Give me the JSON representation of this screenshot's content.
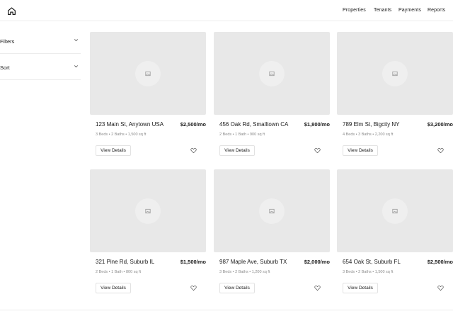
{
  "icons": {
    "home": "home-icon",
    "chevron": "chevron-down-icon",
    "placeholder": "image-placeholder-icon",
    "favorite": "heart-icon"
  },
  "nav": {
    "items": [
      {
        "label": "Properties"
      },
      {
        "label": "Tenants"
      },
      {
        "label": "Payments"
      },
      {
        "label": "Reports"
      }
    ]
  },
  "sidebar": {
    "filters_label": "Filters",
    "sort_label": "Sort"
  },
  "listings": [
    {
      "address": "123 Main St, Anytown USA",
      "price": "$2,500/mo",
      "meta": "3 Beds • 2 Baths • 1,500 sq ft",
      "button": "View Details"
    },
    {
      "address": "456 Oak Rd, Smalltown CA",
      "price": "$1,800/mo",
      "meta": "2 Beds • 1 Bath • 900 sq ft",
      "button": "View Details"
    },
    {
      "address": "789 Elm St, Bigcity NY",
      "price": "$3,200/mo",
      "meta": "4 Beds • 3 Baths • 2,200 sq ft",
      "button": "View Details"
    },
    {
      "address": "321 Pine Rd, Suburb IL",
      "price": "$1,500/mo",
      "meta": "2 Beds • 1 Bath • 800 sq ft",
      "button": "View Details"
    },
    {
      "address": "987 Maple Ave, Suburb TX",
      "price": "$2,000/mo",
      "meta": "3 Beds • 2 Baths • 1,200 sq ft",
      "button": "View Details"
    },
    {
      "address": "654 Oak St, Suburb FL",
      "price": "$2,500/mo",
      "meta": "3 Beds • 2 Baths • 1,500 sq ft",
      "button": "View Details"
    }
  ]
}
